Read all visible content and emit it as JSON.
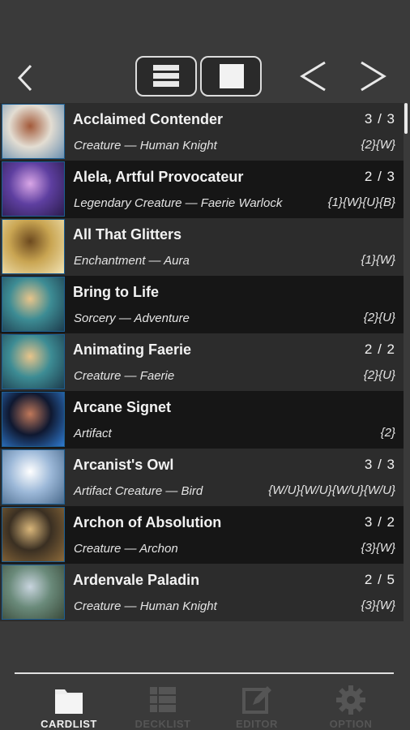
{
  "header": {
    "back_icon": "chevron-left-icon",
    "view_list_icon": "list-view-icon",
    "view_single_icon": "single-card-view-icon",
    "prev_icon": "chevron-left-icon",
    "next_icon": "chevron-right-icon"
  },
  "cards": [
    {
      "name": "Acclaimed Contender",
      "pt": "3 / 3",
      "type": "Creature — Human Knight",
      "cost": "{2}{W}"
    },
    {
      "name": "Alela, Artful Provocateur",
      "pt": "2 / 3",
      "type": "Legendary Creature — Faerie Warlock",
      "cost": "{1}{W}{U}{B}"
    },
    {
      "name": "All That Glitters",
      "pt": "",
      "type": "Enchantment — Aura",
      "cost": "{1}{W}"
    },
    {
      "name": "Bring to Life",
      "pt": "",
      "type": "Sorcery — Adventure",
      "cost": "{2}{U}"
    },
    {
      "name": "Animating Faerie",
      "pt": "2 / 2",
      "type": "Creature — Faerie",
      "cost": "{2}{U}"
    },
    {
      "name": "Arcane Signet",
      "pt": "",
      "type": "Artifact",
      "cost": "{2}"
    },
    {
      "name": "Arcanist's Owl",
      "pt": "3 / 3",
      "type": "Artifact Creature — Bird",
      "cost": "{W/U}{W/U}{W/U}{W/U}"
    },
    {
      "name": "Archon of Absolution",
      "pt": "3 / 2",
      "type": "Creature — Archon",
      "cost": "{3}{W}"
    },
    {
      "name": "Ardenvale Paladin",
      "pt": "2 / 5",
      "type": "Creature — Human Knight",
      "cost": "{3}{W}"
    }
  ],
  "tabs": [
    {
      "label": "CARDLIST",
      "icon": "folder-icon",
      "active": true
    },
    {
      "label": "DECKLIST",
      "icon": "grid-list-icon",
      "active": false
    },
    {
      "label": "EDITOR",
      "icon": "edit-icon",
      "active": false
    },
    {
      "label": "OPTION",
      "icon": "gear-icon",
      "active": false
    }
  ],
  "colors": {
    "background": "#3a3a3a",
    "row_odd": "#2c2c2c",
    "row_even": "#161616",
    "thumb_border": "#1d5f93",
    "inactive_tab": "#555555"
  }
}
